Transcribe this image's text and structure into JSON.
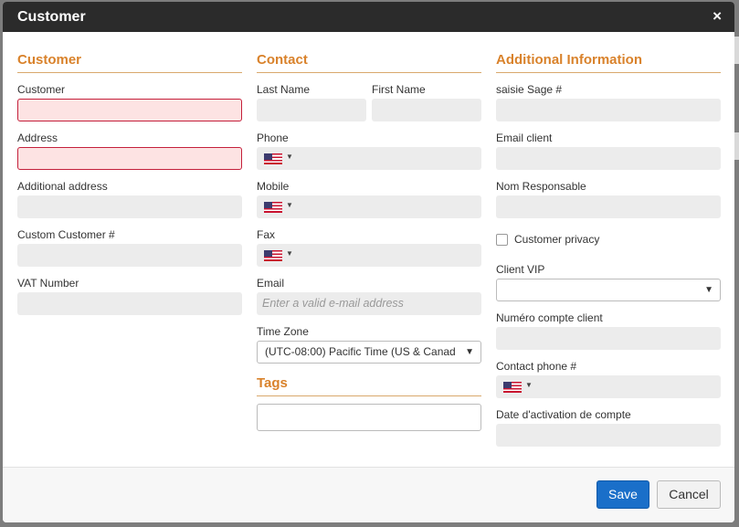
{
  "modal": {
    "title": "Customer",
    "close_label": "×"
  },
  "col_customer": {
    "title": "Customer",
    "customer_label": "Customer",
    "address_label": "Address",
    "additional_address_label": "Additional address",
    "custom_customer_label": "Custom Customer #",
    "vat_label": "VAT Number"
  },
  "col_contact": {
    "title": "Contact",
    "last_name_label": "Last Name",
    "first_name_label": "First Name",
    "phone_label": "Phone",
    "mobile_label": "Mobile",
    "fax_label": "Fax",
    "email_label": "Email",
    "email_placeholder": "Enter a valid e-mail address",
    "timezone_label": "Time Zone",
    "timezone_value": "(UTC-08:00) Pacific Time (US & Canad",
    "tags_title": "Tags",
    "phone_country_icon": "us-flag-icon"
  },
  "col_additional": {
    "title": "Additional Information",
    "saisie_label": "saisie Sage #",
    "email_client_label": "Email client",
    "nom_resp_label": "Nom Responsable",
    "privacy_label": "Customer privacy",
    "privacy_checked": false,
    "vip_label": "Client VIP",
    "vip_value": "",
    "numero_label": "Numéro compte client",
    "contact_phone_label": "Contact phone #",
    "date_label": "Date d'activation de compte"
  },
  "footer": {
    "save_label": "Save",
    "cancel_label": "Cancel"
  },
  "colors": {
    "header_bg": "#2b2b2b",
    "section_title": "#d9822b",
    "error_border": "#c4203b",
    "error_bg": "#fde3e3",
    "primary_button": "#1a6fc9"
  }
}
